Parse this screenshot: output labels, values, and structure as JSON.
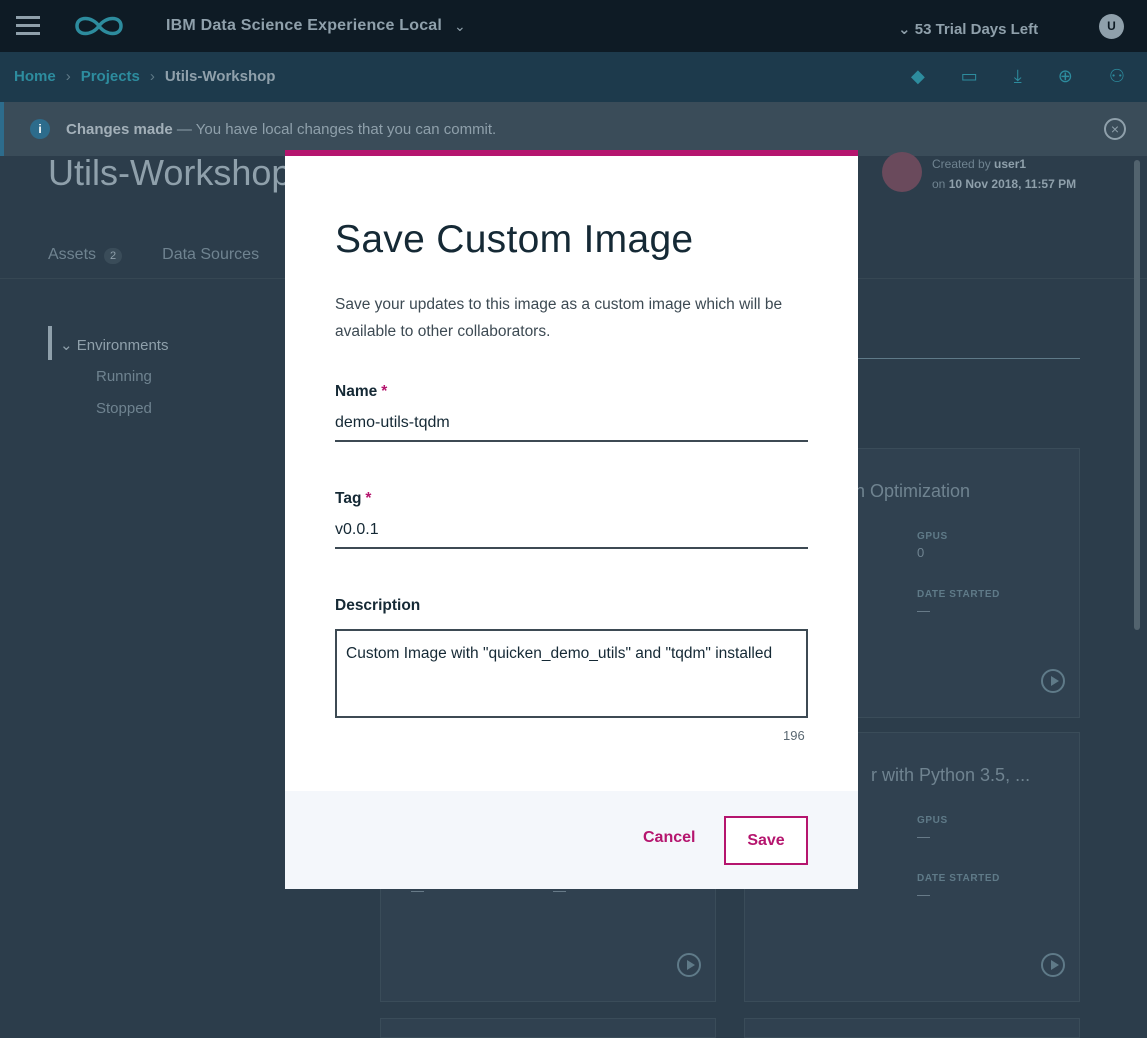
{
  "header": {
    "product_name": "IBM Data Science Experience Local",
    "trial_text": "53 Trial Days Left",
    "user_initial": "U"
  },
  "breadcrumb": {
    "items": [
      "Home",
      "Projects",
      "Utils-Workshop"
    ]
  },
  "notification": {
    "title": "Changes made",
    "message": " — You have local changes that you can commit."
  },
  "project": {
    "title": "Utils-Workshop",
    "created_by_label": "Created by",
    "created_by_user": "user1",
    "created_on_prefix": "on",
    "created_on": "10 Nov 2018, 11:57 PM",
    "tabs": [
      {
        "label": "Assets",
        "badge": "2"
      },
      {
        "label": "Data Sources"
      }
    ],
    "environments": {
      "heading": "Environments",
      "items": [
        "Running",
        "Stopped"
      ]
    },
    "cards": [
      {
        "title": "on Optimization",
        "gpus_label": "GPUS",
        "gpus_value": "0",
        "date_label": "DATE STARTED",
        "date_value": "—"
      },
      {
        "title": "r with Python 3.5, ...",
        "gpus_label": "GPUS",
        "gpus_value": "—",
        "date_label": "DATE STARTED",
        "date_value": "—"
      },
      {
        "value_a": "—",
        "value_b": "—"
      }
    ]
  },
  "modal": {
    "title": "Save Custom Image",
    "description": "Save your updates to this image as a custom image which will be available to other collaborators.",
    "name_label": "Name",
    "name_value": "demo-utils-tqdm",
    "tag_label": "Tag",
    "tag_value": "v0.0.1",
    "required_marker": "*",
    "description_label": "Description",
    "description_value": "Custom Image with \"quicken_demo_utils\" and \"tqdm\" installed",
    "char_count": "196",
    "cancel_label": "Cancel",
    "save_label": "Save"
  },
  "colors": {
    "accent": "#b5156e",
    "header_bg": "#0e1b25",
    "page_bg": "#2c3d4b",
    "link": "#2d8c9e"
  }
}
